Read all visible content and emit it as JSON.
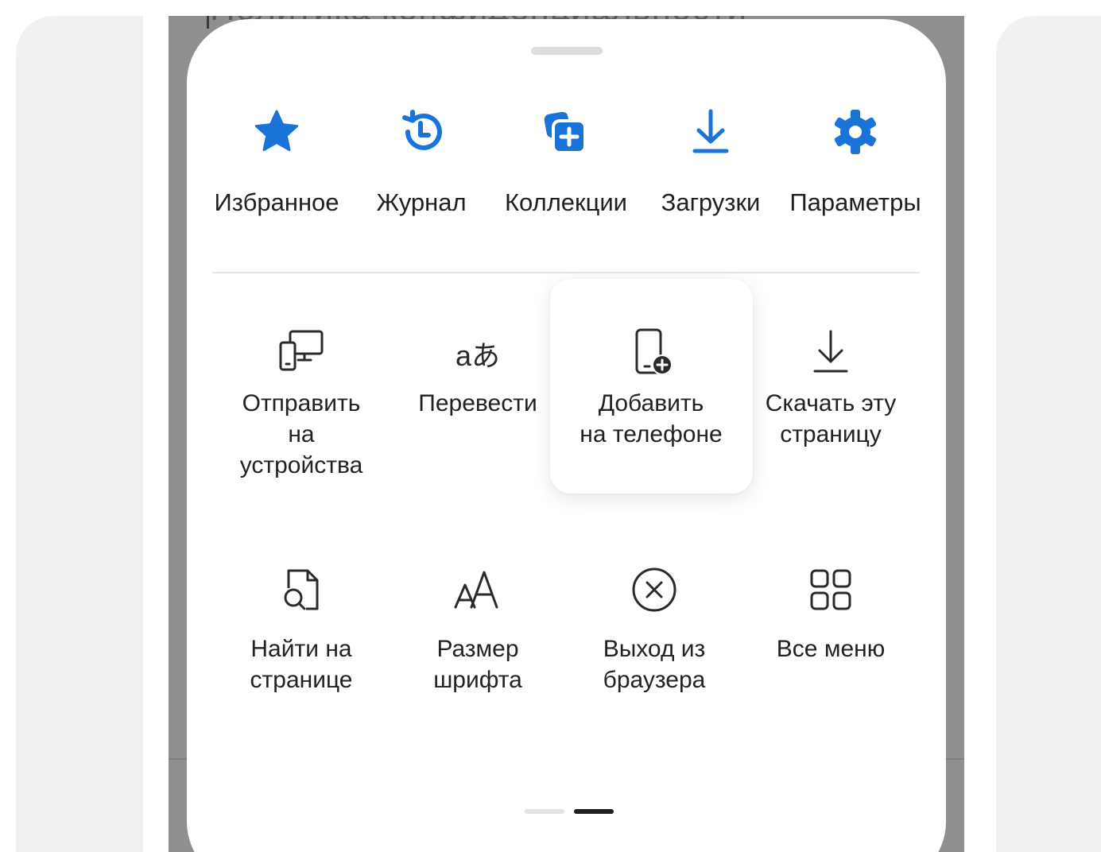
{
  "background_text": "Политика конфиденциальности",
  "colors": {
    "accent": "#1a73d9",
    "icon_dark": "#2a2a2a",
    "sheet_bg": "#ffffff",
    "scrim": "#8f8f8f"
  },
  "quick_actions": [
    {
      "id": "favorites",
      "label": "Избранное",
      "icon": "star-icon"
    },
    {
      "id": "history",
      "label": "Журнал",
      "icon": "history-icon"
    },
    {
      "id": "collections",
      "label": "Коллекции",
      "icon": "collections-add-icon"
    },
    {
      "id": "downloads",
      "label": "Загрузки",
      "icon": "download-icon"
    },
    {
      "id": "settings",
      "label": "Параметры",
      "icon": "gear-icon"
    }
  ],
  "menu_items": [
    {
      "id": "send-to-devices",
      "label_lines": [
        "Отправить",
        "на",
        "устройства"
      ],
      "icon": "send-to-devices-icon"
    },
    {
      "id": "translate",
      "label_lines": [
        "Перевести"
      ],
      "icon": "translate-icon",
      "glyph": "aあ"
    },
    {
      "id": "add-to-phone",
      "label_lines": [
        "Добавить",
        "на телефоне"
      ],
      "icon": "phone-add-icon",
      "highlighted": true
    },
    {
      "id": "download-page",
      "label_lines": [
        "Скачать эту",
        "страницу"
      ],
      "icon": "download-icon"
    },
    {
      "id": "find-on-page",
      "label_lines": [
        "Найти на",
        "странице"
      ],
      "icon": "find-in-page-icon"
    },
    {
      "id": "font-size",
      "label_lines": [
        "Размер",
        "шрифта"
      ],
      "icon": "font-size-icon"
    },
    {
      "id": "exit-browser",
      "label_lines": [
        "Выход из",
        "браузера"
      ],
      "icon": "close-circle-icon"
    },
    {
      "id": "all-menu",
      "label_lines": [
        "Все меню"
      ],
      "icon": "grid-icon"
    }
  ],
  "pager": {
    "pages": 2,
    "current": 2
  }
}
